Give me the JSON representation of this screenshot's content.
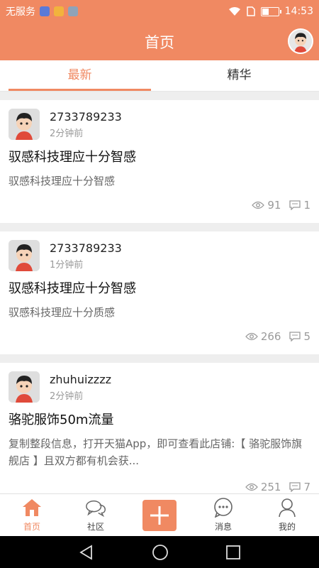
{
  "status_bar": {
    "carrier": "无服务",
    "time": "14:53"
  },
  "header": {
    "title": "首页"
  },
  "tabs": [
    {
      "label": "最新",
      "active": true
    },
    {
      "label": "精华",
      "active": false
    }
  ],
  "posts": [
    {
      "username": "2733789233",
      "time": "2分钟前",
      "title": "驭感科技理应十分智感",
      "body": "驭感科技理应十分智感",
      "views": "91",
      "comments": "1"
    },
    {
      "username": "2733789233",
      "time": "1分钟前",
      "title": "驭感科技理应十分智感",
      "body": "驭感科技理应十分质感",
      "views": "266",
      "comments": "5"
    },
    {
      "username": "zhuhuizzzz",
      "time": "2分钟前",
      "title": "骆驼服饰50m流量",
      "body": "复制整段信息，打开天猫App，即可查看此店铺:【 骆驼服饰旗舰店 】且双方都有机会获...",
      "views": "251",
      "comments": "7"
    }
  ],
  "bottom_nav": [
    {
      "label": "首页",
      "icon": "home-icon",
      "active": true
    },
    {
      "label": "社区",
      "icon": "chat-bubbles-icon",
      "active": false
    },
    {
      "label": "",
      "icon": "plus-icon",
      "active": false
    },
    {
      "label": "消息",
      "icon": "message-icon",
      "active": false
    },
    {
      "label": "我的",
      "icon": "person-icon",
      "active": false
    }
  ],
  "colors": {
    "accent": "#f08962",
    "background": "#eeeeee"
  }
}
